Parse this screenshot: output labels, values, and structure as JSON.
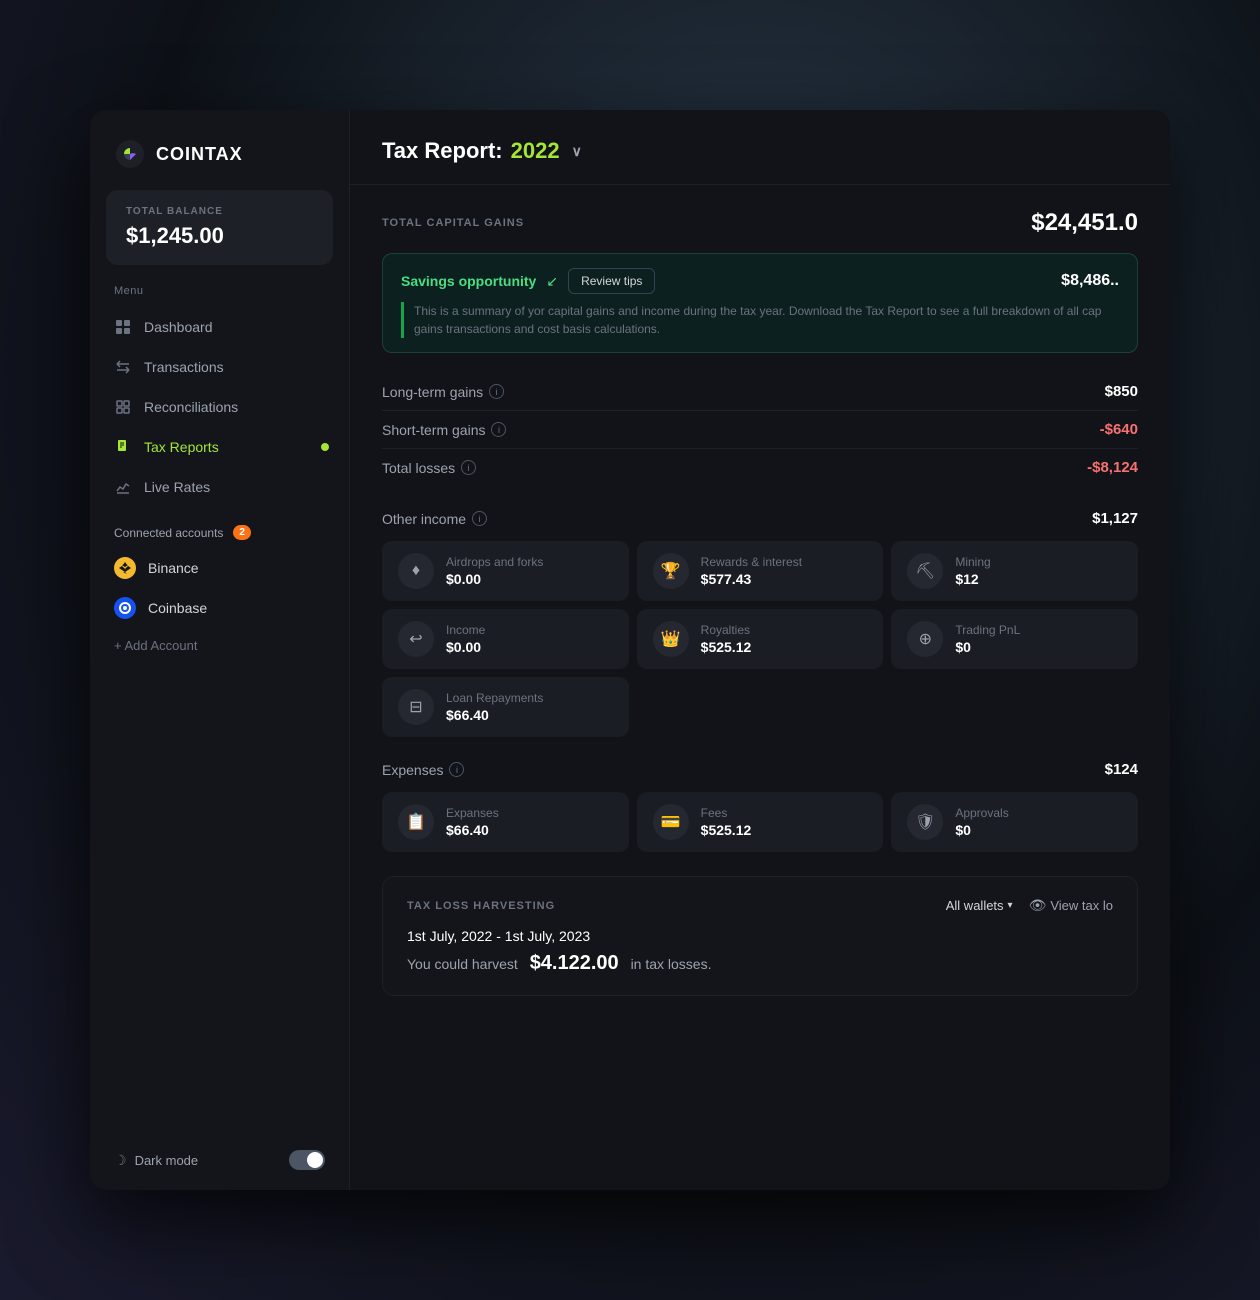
{
  "app": {
    "name": "COINTAX",
    "window_title": "Tax Report"
  },
  "sidebar": {
    "balance": {
      "label": "TOTAL BALANCE",
      "value": "$1,245.00"
    },
    "menu_label": "Menu",
    "nav_items": [
      {
        "id": "dashboard",
        "label": "Dashboard",
        "icon": "grid",
        "active": false
      },
      {
        "id": "transactions",
        "label": "Transactions",
        "icon": "arrows",
        "active": false
      },
      {
        "id": "reconciliations",
        "label": "Reconciliations",
        "icon": "reconcile",
        "active": false
      },
      {
        "id": "tax-reports",
        "label": "Tax Reports",
        "icon": "file",
        "active": true,
        "dot": true
      },
      {
        "id": "live-rates",
        "label": "Live Rates",
        "icon": "chart",
        "active": false
      }
    ],
    "connected_accounts": {
      "label": "Connected accounts",
      "badge": "2",
      "accounts": [
        {
          "id": "binance",
          "label": "Binance",
          "icon_color": "#f3ba2f",
          "icon_letter": "B"
        },
        {
          "id": "coinbase",
          "label": "Coinbase",
          "icon_color": "#1652f0",
          "icon_letter": "C"
        }
      ],
      "add_label": "+ Add Account"
    },
    "dark_mode": {
      "label": "Dark mode",
      "enabled": true
    }
  },
  "header": {
    "title_prefix": "Tax Report: ",
    "year": "2022",
    "dropdown_symbol": "∨"
  },
  "main": {
    "capital_gains": {
      "section_label": "TOTAL CAPITAL GAINS",
      "total": "$24,451.0",
      "savings_opportunity": {
        "label": "Savings opportunity",
        "arrow": "↙",
        "review_btn": "Review tips",
        "amount": "$8,486..",
        "description": "This is a summary of yor capital gains and income during the tax year. Download the Tax Report to see a full breakdown of all cap gains transactions and cost basis calculations."
      },
      "rows": [
        {
          "label": "Long-term gains",
          "value": "$850",
          "negative": false
        },
        {
          "label": "Short-term gains",
          "value": "-$640",
          "negative": true
        },
        {
          "label": "Total losses",
          "value": "-$8,124",
          "negative": true
        }
      ]
    },
    "other_income": {
      "label": "Other income",
      "total": "$1,127",
      "cards": [
        {
          "id": "airdrops",
          "label": "Airdrops and forks",
          "value": "$0.00",
          "icon": "♦"
        },
        {
          "id": "rewards",
          "label": "Rewards & interest",
          "value": "$577.43",
          "icon": "🏆"
        },
        {
          "id": "mining",
          "label": "Mining",
          "value": "$12",
          "icon": "⛏"
        },
        {
          "id": "income",
          "label": "Income",
          "value": "$0.00",
          "icon": "↩"
        },
        {
          "id": "royalties",
          "label": "Royalties",
          "value": "$525.12",
          "icon": "👑"
        },
        {
          "id": "trading",
          "label": "Trading PnL",
          "value": "$0",
          "icon": "⊕"
        },
        {
          "id": "loan",
          "label": "Loan Repayments",
          "value": "$66.40",
          "icon": "⊟"
        }
      ]
    },
    "expenses": {
      "label": "Expenses",
      "total": "$124",
      "cards": [
        {
          "id": "expanses",
          "label": "Expanses",
          "value": "$66.40",
          "icon": "📋"
        },
        {
          "id": "fees",
          "label": "Fees",
          "value": "$525.12",
          "icon": "💳"
        },
        {
          "id": "approvals",
          "label": "Approvals",
          "value": "$0",
          "icon": "🛡"
        }
      ]
    },
    "tax_loss_harvesting": {
      "section_label": "TAX LOSS HARVESTING",
      "all_wallets_label": "All wallets",
      "view_tax_label": "View tax lo",
      "date_range": "1st July, 2022 - 1st July, 2023",
      "harvest_prefix": "You could harvest",
      "harvest_amount": "$4.122.00",
      "harvest_suffix": "in tax losses."
    }
  }
}
